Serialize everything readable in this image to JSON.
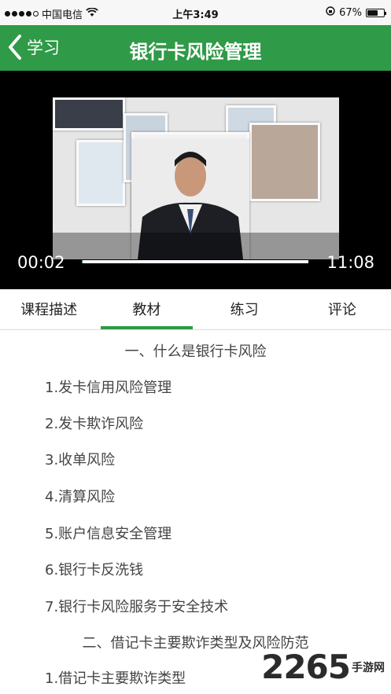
{
  "status_bar": {
    "carrier": "中国电信",
    "time": "上午3:49",
    "battery_percent": "67%",
    "battery_level": 0.67
  },
  "header": {
    "back_label": "学习",
    "title": "银行卡风险管理"
  },
  "video": {
    "current_time": "00:02",
    "duration": "11:08",
    "progress": 0.003
  },
  "tabs": [
    {
      "label": "课程描述",
      "active": false
    },
    {
      "label": "教材",
      "active": true
    },
    {
      "label": "练习",
      "active": false
    },
    {
      "label": "评论",
      "active": false
    }
  ],
  "content": {
    "section1": "一、什么是银行卡风险",
    "items": [
      "1.发卡信用风险管理",
      "2.发卡欺诈风险",
      "3.收单风险",
      "4.清算风险",
      "5.账户信息安全管理",
      "6.银行卡反洗钱",
      "7.银行卡风险服务于安全技术"
    ],
    "section2": "二、借记卡主要欺诈类型及风险防范",
    "items2": [
      "1.借记卡主要欺诈类型"
    ]
  },
  "watermark": {
    "logo": "2265",
    "sub": "手游网"
  },
  "colors": {
    "brand_green": "#2f9a47",
    "video_bg": "#000000"
  }
}
